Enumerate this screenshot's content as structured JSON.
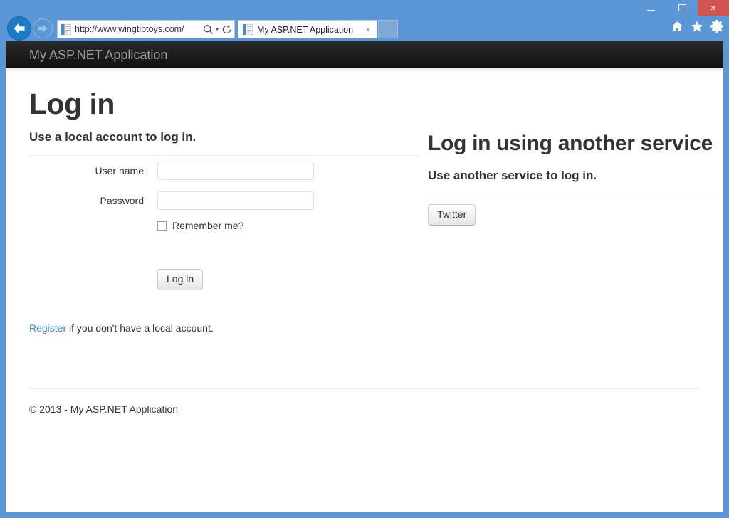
{
  "browser": {
    "back_label": "Back",
    "forward_label": "Forward",
    "address": {
      "url": "http://www.wingtiptoys.com/",
      "scheme_text": "http://",
      "host_text": "www.wingtiptoys.com/",
      "search_icon": "search-icon",
      "refresh_icon": "refresh-icon",
      "favicon": "page-icon"
    },
    "tab": {
      "title": "My ASP.NET Application",
      "close_label": "×",
      "favicon": "page-icon"
    },
    "new_tab_label": "",
    "window_controls": {
      "minimize_label": "",
      "maximize_label": "",
      "close_label": "×"
    },
    "command_icons": [
      {
        "name": "home-icon",
        "label": "Home"
      },
      {
        "name": "favorites-star-icon",
        "label": "Favorites"
      },
      {
        "name": "tools-gear-icon",
        "label": "Tools"
      }
    ]
  },
  "site": {
    "brand": "My ASP.NET Application"
  },
  "page": {
    "title": "Log in",
    "local": {
      "subtitle": "Use a local account to log in.",
      "fields": [
        {
          "label": "User name",
          "value": "",
          "placeholder": "",
          "type": "text",
          "name": "username"
        },
        {
          "label": "Password",
          "value": "",
          "placeholder": "",
          "type": "password",
          "name": "password"
        }
      ],
      "remember_label": "Remember me?",
      "remember_checked": false,
      "submit_label": "Log in",
      "register_link_text": "Register",
      "register_rest_text": " if you don't have a local account."
    },
    "external": {
      "title": "Log in using another service",
      "subtitle": "Use another service to log in.",
      "providers": [
        {
          "label": "Twitter"
        }
      ]
    },
    "footer": {
      "text": "© 2013 - My ASP.NET Application"
    }
  },
  "colors": {
    "chrome_blue": "#5b96d6",
    "close_red": "#d2544f",
    "navbar_dark": "#1a1a1a",
    "brand_text": "#9d9d9d",
    "link_blue": "#428bca",
    "body_text": "#333333",
    "rule": "#eeeeee"
  }
}
